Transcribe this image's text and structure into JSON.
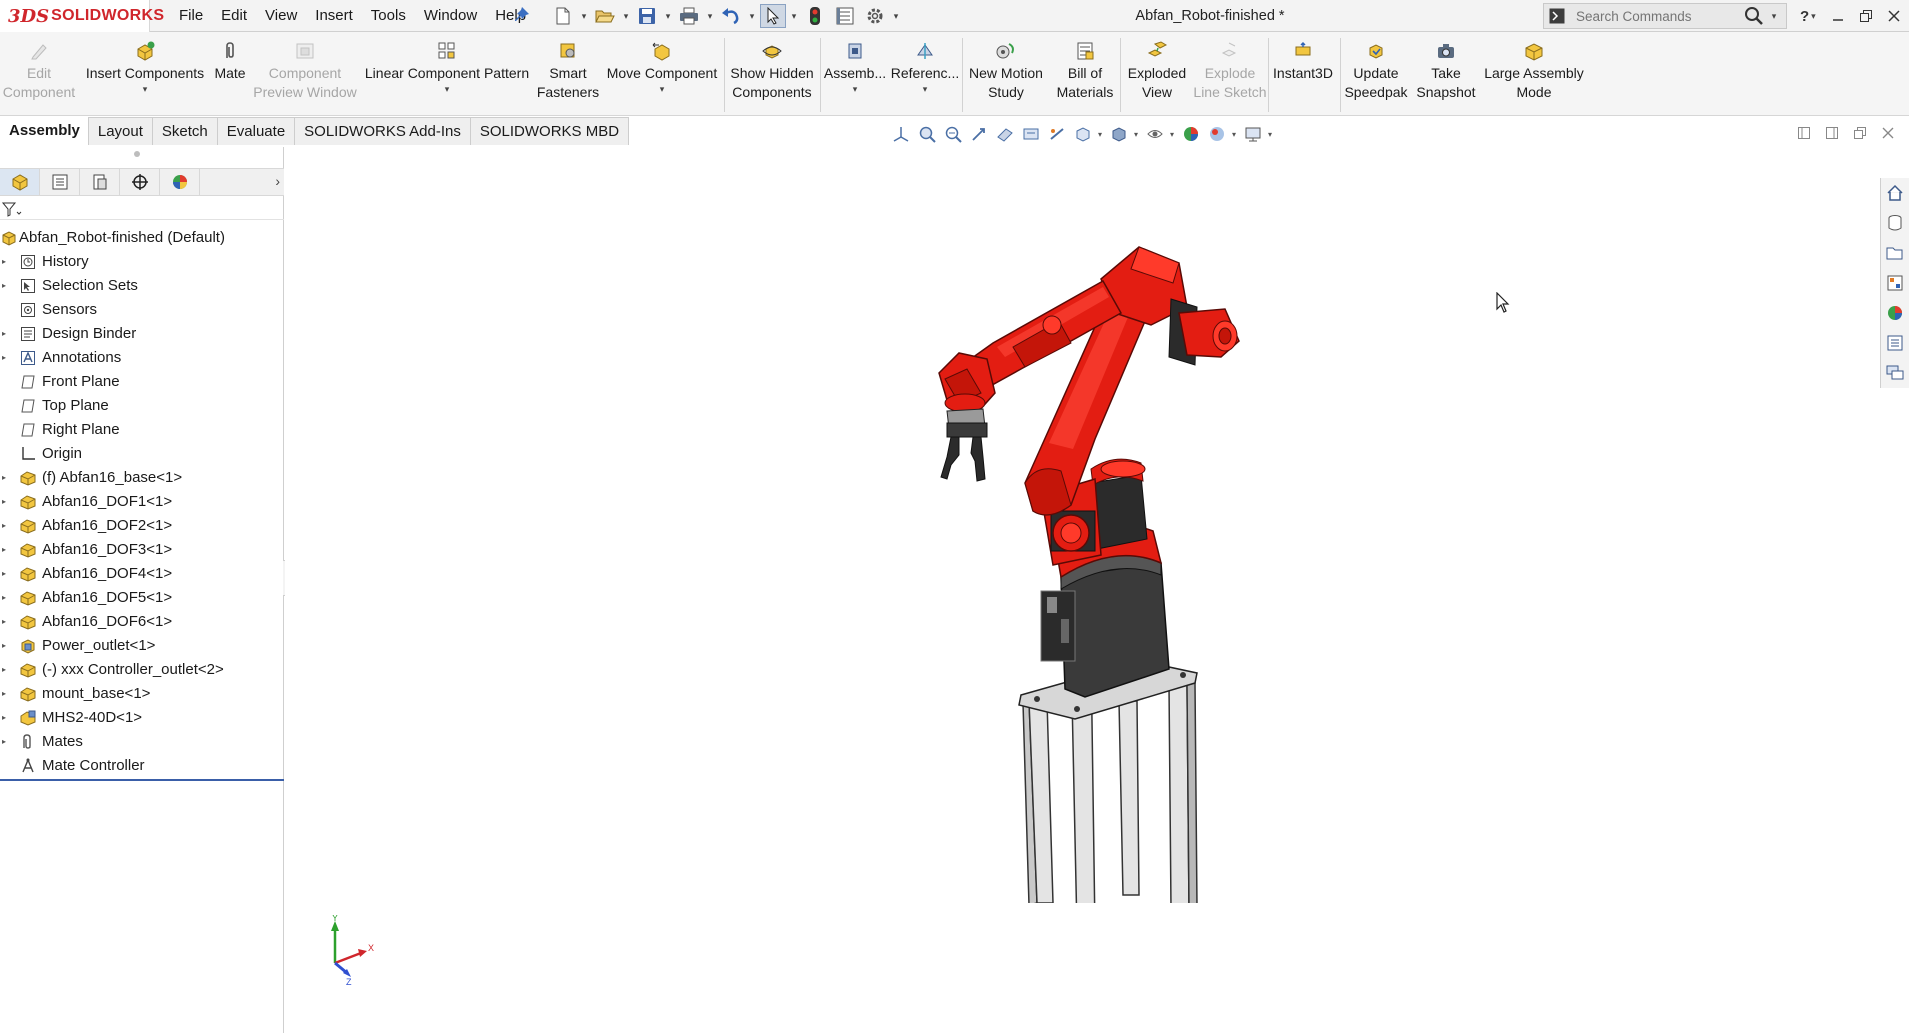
{
  "app": {
    "logo_mark": "3DS",
    "logo_name": "SOLIDWORKS",
    "document_title": "Abfan_Robot-finished *"
  },
  "menu": [
    "File",
    "Edit",
    "View",
    "Insert",
    "Tools",
    "Window",
    "Help"
  ],
  "search": {
    "placeholder": "Search Commands"
  },
  "help": {
    "label": "?"
  },
  "ribbon": {
    "edit_component": [
      "Edit",
      "Component"
    ],
    "insert_components": [
      "Insert Components"
    ],
    "mate": [
      "Mate"
    ],
    "component_preview": [
      "Component",
      "Preview Window"
    ],
    "linear_pattern": [
      "Linear Component Pattern"
    ],
    "smart_fasteners": [
      "Smart",
      "Fasteners"
    ],
    "move_component": [
      "Move Component"
    ],
    "show_hidden": [
      "Show Hidden",
      "Components"
    ],
    "assembly_features": [
      "Assemb..."
    ],
    "reference_geometry": [
      "Referenc..."
    ],
    "new_motion_study": [
      "New Motion",
      "Study"
    ],
    "bill_of_materials": [
      "Bill of",
      "Materials"
    ],
    "exploded_view": [
      "Exploded",
      "View"
    ],
    "explode_line_sketch": [
      "Explode",
      "Line Sketch"
    ],
    "instant3d": [
      "Instant3D"
    ],
    "update_speedpak": [
      "Update",
      "Speedpak"
    ],
    "take_snapshot": [
      "Take",
      "Snapshot"
    ],
    "large_assembly_mode": [
      "Large Assembly",
      "Mode"
    ]
  },
  "tabs": [
    "Assembly",
    "Layout",
    "Sketch",
    "Evaluate",
    "SOLIDWORKS Add-Ins",
    "SOLIDWORKS MBD"
  ],
  "tree": {
    "root": "Abfan_Robot-finished  (Default)",
    "items": [
      "History",
      "Selection Sets",
      "Sensors",
      "Design Binder",
      "Annotations",
      "Front Plane",
      "Top Plane",
      "Right Plane",
      "Origin",
      "(f) Abfan16_base<1>",
      "Abfan16_DOF1<1>",
      "Abfan16_DOF2<1>",
      "Abfan16_DOF3<1>",
      "Abfan16_DOF4<1>",
      "Abfan16_DOF5<1>",
      "Abfan16_DOF6<1>",
      "Power_outlet<1>",
      "(-) xxx Controller_outlet<2>",
      "mount_base<1>",
      "MHS2-40D<1>",
      "Mates",
      "Mate Controller"
    ]
  },
  "triad": {
    "x": "X",
    "y": "Y",
    "z": "Z"
  },
  "colors": {
    "brand_red": "#d0262c",
    "robot_red": "#e31d12",
    "robot_dark": "#2b2b2b",
    "leg_gray": "#c9c9c9",
    "tab_active_bg": "#ffffff",
    "tree_end_line": "#3a5ea8"
  }
}
